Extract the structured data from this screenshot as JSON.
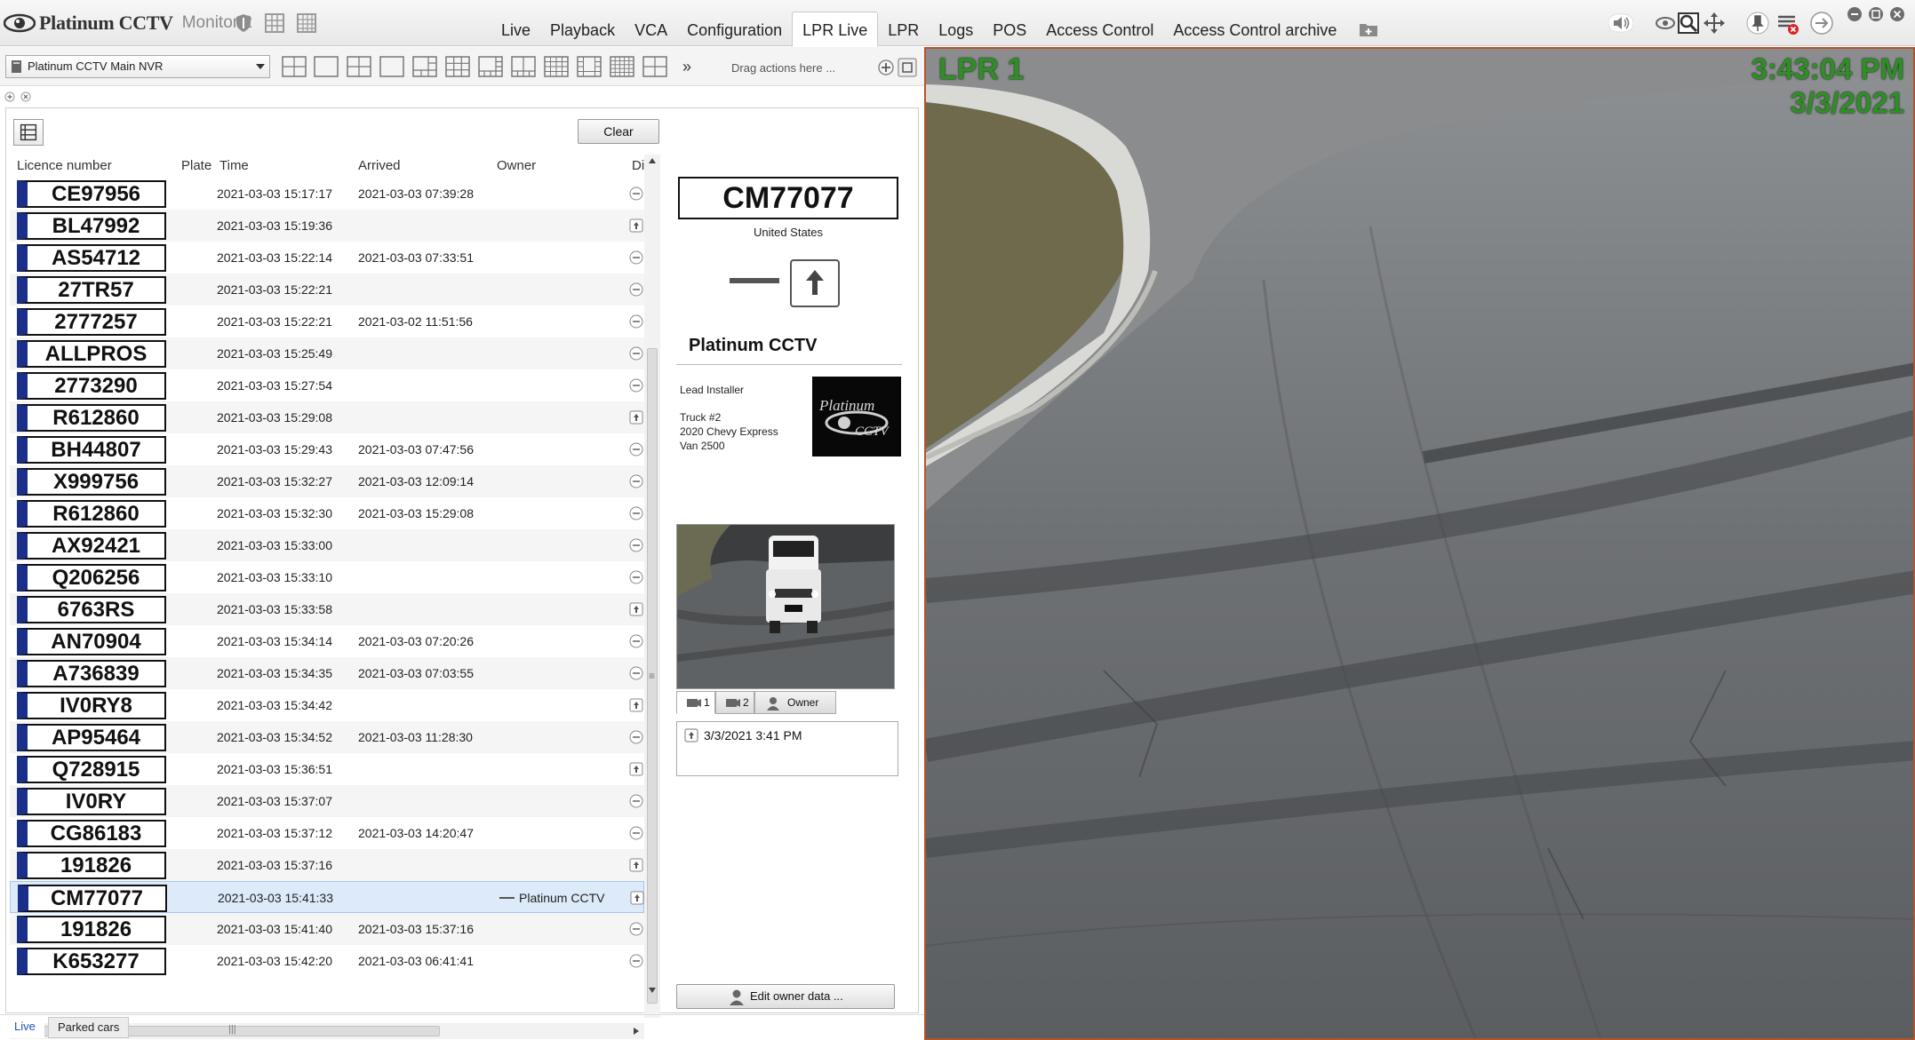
{
  "app": {
    "brand": "Platinum CCTV",
    "monitor": "Monitor 2"
  },
  "nav": {
    "tabs": [
      "Live",
      "Playback",
      "VCA",
      "Configuration",
      "LPR Live",
      "LPR",
      "Logs",
      "POS",
      "Access Control",
      "Access Control archive"
    ],
    "active": "LPR Live"
  },
  "toolbar": {
    "server": "Platinum CCTV Main NVR",
    "more": "»",
    "drag_hint": "Drag actions here ..."
  },
  "lpr": {
    "clear_label": "Clear",
    "columns": [
      "Licence number",
      "Plate",
      "Time",
      "Arrived",
      "Owner",
      "Di"
    ],
    "rows": [
      {
        "plate": "CE97956",
        "time": "2021-03-03 15:17:17",
        "arrived": "2021-03-03 07:39:28",
        "owner": "",
        "dir": "none"
      },
      {
        "plate": "BL47992",
        "time": "2021-03-03 15:19:36",
        "arrived": "",
        "owner": "",
        "dir": "up"
      },
      {
        "plate": "AS54712",
        "time": "2021-03-03 15:22:14",
        "arrived": "2021-03-03 07:33:51",
        "owner": "",
        "dir": "none"
      },
      {
        "plate": "27TR57",
        "time": "2021-03-03 15:22:21",
        "arrived": "",
        "owner": "",
        "dir": "none"
      },
      {
        "plate": "2777257",
        "time": "2021-03-03 15:22:21",
        "arrived": "2021-03-02 11:51:56",
        "owner": "",
        "dir": "none"
      },
      {
        "plate": "ALLPROS",
        "time": "2021-03-03 15:25:49",
        "arrived": "",
        "owner": "",
        "dir": "none"
      },
      {
        "plate": "2773290",
        "time": "2021-03-03 15:27:54",
        "arrived": "",
        "owner": "",
        "dir": "none"
      },
      {
        "plate": "R612860",
        "time": "2021-03-03 15:29:08",
        "arrived": "",
        "owner": "",
        "dir": "up"
      },
      {
        "plate": "BH44807",
        "time": "2021-03-03 15:29:43",
        "arrived": "2021-03-03 07:47:56",
        "owner": "",
        "dir": "none"
      },
      {
        "plate": "X999756",
        "time": "2021-03-03 15:32:27",
        "arrived": "2021-03-03 12:09:14",
        "owner": "",
        "dir": "none"
      },
      {
        "plate": "R612860",
        "time": "2021-03-03 15:32:30",
        "arrived": "2021-03-03 15:29:08",
        "owner": "",
        "dir": "none"
      },
      {
        "plate": "AX92421",
        "time": "2021-03-03 15:33:00",
        "arrived": "",
        "owner": "",
        "dir": "none"
      },
      {
        "plate": "Q206256",
        "time": "2021-03-03 15:33:10",
        "arrived": "",
        "owner": "",
        "dir": "none"
      },
      {
        "plate": "6763RS",
        "time": "2021-03-03 15:33:58",
        "arrived": "",
        "owner": "",
        "dir": "up"
      },
      {
        "plate": "AN70904",
        "time": "2021-03-03 15:34:14",
        "arrived": "2021-03-03 07:20:26",
        "owner": "",
        "dir": "none"
      },
      {
        "plate": "A736839",
        "time": "2021-03-03 15:34:35",
        "arrived": "2021-03-03 07:03:55",
        "owner": "",
        "dir": "none"
      },
      {
        "plate": "IV0RY8",
        "time": "2021-03-03 15:34:42",
        "arrived": "",
        "owner": "",
        "dir": "up"
      },
      {
        "plate": "AP95464",
        "time": "2021-03-03 15:34:52",
        "arrived": "2021-03-03 11:28:30",
        "owner": "",
        "dir": "none"
      },
      {
        "plate": "Q728915",
        "time": "2021-03-03 15:36:51",
        "arrived": "",
        "owner": "",
        "dir": "up"
      },
      {
        "plate": "IV0RY",
        "time": "2021-03-03 15:37:07",
        "arrived": "",
        "owner": "",
        "dir": "none"
      },
      {
        "plate": "CG86183",
        "time": "2021-03-03 15:37:12",
        "arrived": "2021-03-03 14:20:47",
        "owner": "",
        "dir": "none"
      },
      {
        "plate": "191826",
        "time": "2021-03-03 15:37:16",
        "arrived": "",
        "owner": "",
        "dir": "up"
      },
      {
        "plate": "CM77077",
        "time": "2021-03-03 15:41:33",
        "arrived": "",
        "owner": "Platinum CCTV",
        "dir": "up"
      },
      {
        "plate": "191826",
        "time": "2021-03-03 15:41:40",
        "arrived": "2021-03-03 15:37:16",
        "owner": "",
        "dir": "none"
      },
      {
        "plate": "K653277",
        "time": "2021-03-03 15:42:20",
        "arrived": "2021-03-03 06:41:41",
        "owner": "",
        "dir": "none"
      }
    ],
    "selected_index": 22
  },
  "detail": {
    "plate": "CM77077",
    "country": "United States",
    "owner_name": "Platinum CCTV",
    "owner_role": "Lead Installer",
    "owner_vehicle": "Truck #2\n2020 Chevy Express\nVan 2500",
    "logo_line1": "Platinum",
    "logo_line2": "CCTV",
    "snapshot_tabs": [
      "1",
      "2",
      "Owner"
    ],
    "event_time": "3/3/2021 3:41 PM",
    "edit_owner_label": "Edit owner data ..."
  },
  "bottom_tabs": [
    "Live",
    "Parked cars"
  ],
  "camera": {
    "title": "LPR 1",
    "time": "3:43:04 PM",
    "date": "3/3/2021"
  },
  "colors": {
    "osd_green": "#2e8f24",
    "plate_stripe": "#1a2f8a",
    "camera_border": "#b5532d",
    "selected_row": "#ddeaf9"
  }
}
